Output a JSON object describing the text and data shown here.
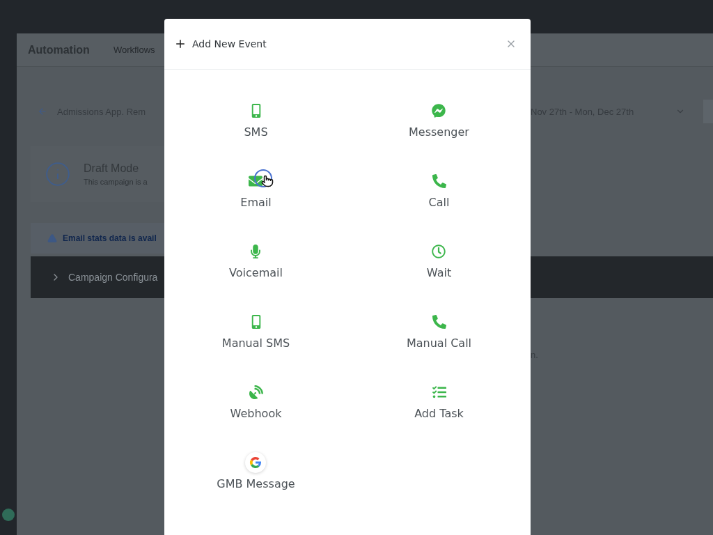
{
  "background": {
    "header": {
      "title": "Automation",
      "tabs": [
        "Workflows"
      ]
    },
    "campaign": {
      "name": "Admissions App. Rem",
      "date_range": "Nov 27th - Mon, Dec 27th"
    },
    "draft": {
      "title": "Draft Mode",
      "text": "This campaign is a"
    },
    "alert": "Email stats data is avail",
    "section": {
      "title": "Campaign Configura",
      "expanded": false
    },
    "note": "n."
  },
  "modal": {
    "title": "Add New Event",
    "events": [
      {
        "kind": "sms",
        "label": "SMS",
        "hovered": false
      },
      {
        "kind": "messenger",
        "label": "Messenger",
        "hovered": false
      },
      {
        "kind": "email",
        "label": "Email",
        "hovered": true
      },
      {
        "kind": "call",
        "label": "Call",
        "hovered": false
      },
      {
        "kind": "voicemail",
        "label": "Voicemail",
        "hovered": false
      },
      {
        "kind": "wait",
        "label": "Wait",
        "hovered": false
      },
      {
        "kind": "sms",
        "label": "Manual SMS",
        "hovered": false
      },
      {
        "kind": "call",
        "label": "Manual Call",
        "hovered": false
      },
      {
        "kind": "webhook",
        "label": "Webhook",
        "hovered": false
      },
      {
        "kind": "task",
        "label": "Add Task",
        "hovered": false
      },
      {
        "kind": "google",
        "label": "GMB Message",
        "hovered": false
      }
    ]
  }
}
